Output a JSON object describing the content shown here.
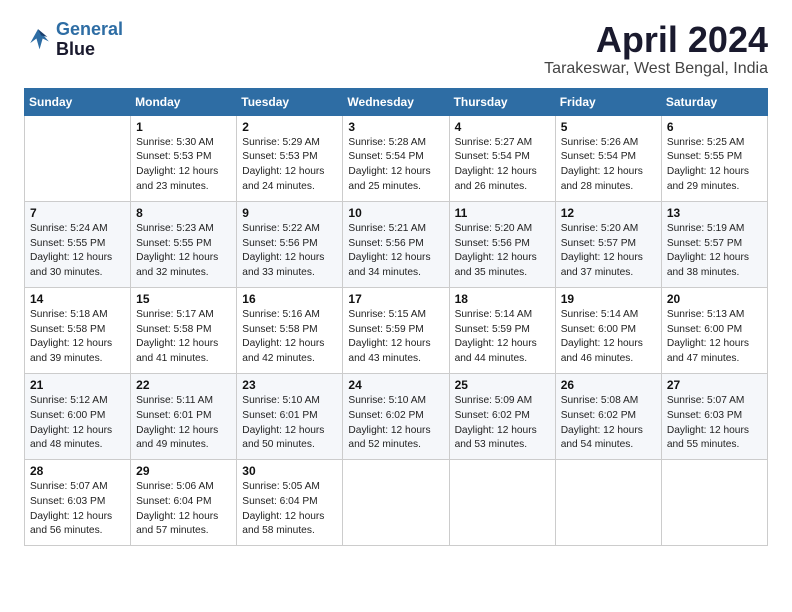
{
  "logo": {
    "line1": "General",
    "line2": "Blue"
  },
  "title": "April 2024",
  "subtitle": "Tarakeswar, West Bengal, India",
  "weekdays": [
    "Sunday",
    "Monday",
    "Tuesday",
    "Wednesday",
    "Thursday",
    "Friday",
    "Saturday"
  ],
  "weeks": [
    [
      {
        "day": "",
        "sunrise": "",
        "sunset": "",
        "daylight": ""
      },
      {
        "day": "1",
        "sunrise": "Sunrise: 5:30 AM",
        "sunset": "Sunset: 5:53 PM",
        "daylight": "Daylight: 12 hours and 23 minutes."
      },
      {
        "day": "2",
        "sunrise": "Sunrise: 5:29 AM",
        "sunset": "Sunset: 5:53 PM",
        "daylight": "Daylight: 12 hours and 24 minutes."
      },
      {
        "day": "3",
        "sunrise": "Sunrise: 5:28 AM",
        "sunset": "Sunset: 5:54 PM",
        "daylight": "Daylight: 12 hours and 25 minutes."
      },
      {
        "day": "4",
        "sunrise": "Sunrise: 5:27 AM",
        "sunset": "Sunset: 5:54 PM",
        "daylight": "Daylight: 12 hours and 26 minutes."
      },
      {
        "day": "5",
        "sunrise": "Sunrise: 5:26 AM",
        "sunset": "Sunset: 5:54 PM",
        "daylight": "Daylight: 12 hours and 28 minutes."
      },
      {
        "day": "6",
        "sunrise": "Sunrise: 5:25 AM",
        "sunset": "Sunset: 5:55 PM",
        "daylight": "Daylight: 12 hours and 29 minutes."
      }
    ],
    [
      {
        "day": "7",
        "sunrise": "Sunrise: 5:24 AM",
        "sunset": "Sunset: 5:55 PM",
        "daylight": "Daylight: 12 hours and 30 minutes."
      },
      {
        "day": "8",
        "sunrise": "Sunrise: 5:23 AM",
        "sunset": "Sunset: 5:55 PM",
        "daylight": "Daylight: 12 hours and 32 minutes."
      },
      {
        "day": "9",
        "sunrise": "Sunrise: 5:22 AM",
        "sunset": "Sunset: 5:56 PM",
        "daylight": "Daylight: 12 hours and 33 minutes."
      },
      {
        "day": "10",
        "sunrise": "Sunrise: 5:21 AM",
        "sunset": "Sunset: 5:56 PM",
        "daylight": "Daylight: 12 hours and 34 minutes."
      },
      {
        "day": "11",
        "sunrise": "Sunrise: 5:20 AM",
        "sunset": "Sunset: 5:56 PM",
        "daylight": "Daylight: 12 hours and 35 minutes."
      },
      {
        "day": "12",
        "sunrise": "Sunrise: 5:20 AM",
        "sunset": "Sunset: 5:57 PM",
        "daylight": "Daylight: 12 hours and 37 minutes."
      },
      {
        "day": "13",
        "sunrise": "Sunrise: 5:19 AM",
        "sunset": "Sunset: 5:57 PM",
        "daylight": "Daylight: 12 hours and 38 minutes."
      }
    ],
    [
      {
        "day": "14",
        "sunrise": "Sunrise: 5:18 AM",
        "sunset": "Sunset: 5:58 PM",
        "daylight": "Daylight: 12 hours and 39 minutes."
      },
      {
        "day": "15",
        "sunrise": "Sunrise: 5:17 AM",
        "sunset": "Sunset: 5:58 PM",
        "daylight": "Daylight: 12 hours and 41 minutes."
      },
      {
        "day": "16",
        "sunrise": "Sunrise: 5:16 AM",
        "sunset": "Sunset: 5:58 PM",
        "daylight": "Daylight: 12 hours and 42 minutes."
      },
      {
        "day": "17",
        "sunrise": "Sunrise: 5:15 AM",
        "sunset": "Sunset: 5:59 PM",
        "daylight": "Daylight: 12 hours and 43 minutes."
      },
      {
        "day": "18",
        "sunrise": "Sunrise: 5:14 AM",
        "sunset": "Sunset: 5:59 PM",
        "daylight": "Daylight: 12 hours and 44 minutes."
      },
      {
        "day": "19",
        "sunrise": "Sunrise: 5:14 AM",
        "sunset": "Sunset: 6:00 PM",
        "daylight": "Daylight: 12 hours and 46 minutes."
      },
      {
        "day": "20",
        "sunrise": "Sunrise: 5:13 AM",
        "sunset": "Sunset: 6:00 PM",
        "daylight": "Daylight: 12 hours and 47 minutes."
      }
    ],
    [
      {
        "day": "21",
        "sunrise": "Sunrise: 5:12 AM",
        "sunset": "Sunset: 6:00 PM",
        "daylight": "Daylight: 12 hours and 48 minutes."
      },
      {
        "day": "22",
        "sunrise": "Sunrise: 5:11 AM",
        "sunset": "Sunset: 6:01 PM",
        "daylight": "Daylight: 12 hours and 49 minutes."
      },
      {
        "day": "23",
        "sunrise": "Sunrise: 5:10 AM",
        "sunset": "Sunset: 6:01 PM",
        "daylight": "Daylight: 12 hours and 50 minutes."
      },
      {
        "day": "24",
        "sunrise": "Sunrise: 5:10 AM",
        "sunset": "Sunset: 6:02 PM",
        "daylight": "Daylight: 12 hours and 52 minutes."
      },
      {
        "day": "25",
        "sunrise": "Sunrise: 5:09 AM",
        "sunset": "Sunset: 6:02 PM",
        "daylight": "Daylight: 12 hours and 53 minutes."
      },
      {
        "day": "26",
        "sunrise": "Sunrise: 5:08 AM",
        "sunset": "Sunset: 6:02 PM",
        "daylight": "Daylight: 12 hours and 54 minutes."
      },
      {
        "day": "27",
        "sunrise": "Sunrise: 5:07 AM",
        "sunset": "Sunset: 6:03 PM",
        "daylight": "Daylight: 12 hours and 55 minutes."
      }
    ],
    [
      {
        "day": "28",
        "sunrise": "Sunrise: 5:07 AM",
        "sunset": "Sunset: 6:03 PM",
        "daylight": "Daylight: 12 hours and 56 minutes."
      },
      {
        "day": "29",
        "sunrise": "Sunrise: 5:06 AM",
        "sunset": "Sunset: 6:04 PM",
        "daylight": "Daylight: 12 hours and 57 minutes."
      },
      {
        "day": "30",
        "sunrise": "Sunrise: 5:05 AM",
        "sunset": "Sunset: 6:04 PM",
        "daylight": "Daylight: 12 hours and 58 minutes."
      },
      {
        "day": "",
        "sunrise": "",
        "sunset": "",
        "daylight": ""
      },
      {
        "day": "",
        "sunrise": "",
        "sunset": "",
        "daylight": ""
      },
      {
        "day": "",
        "sunrise": "",
        "sunset": "",
        "daylight": ""
      },
      {
        "day": "",
        "sunrise": "",
        "sunset": "",
        "daylight": ""
      }
    ]
  ]
}
